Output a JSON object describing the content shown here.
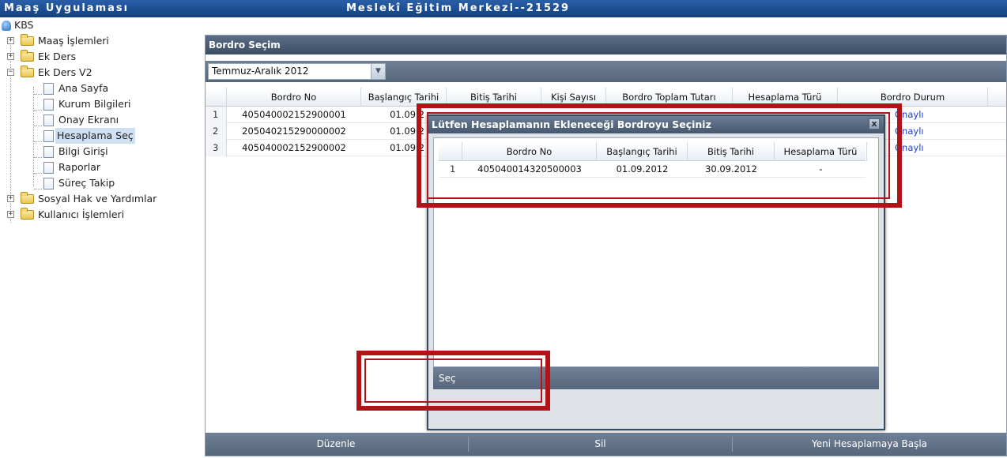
{
  "topbar": {
    "app_title": "Maaş Uygulaması",
    "center_title": "Meslekî Eğitim Merkezi--21529"
  },
  "tree": {
    "root": "KBS",
    "nodes": [
      {
        "label": "Maaş İşlemleri",
        "type": "folder",
        "expander": "+"
      },
      {
        "label": "Ek Ders",
        "type": "folder",
        "expander": "+"
      },
      {
        "label": "Ek Ders V2",
        "type": "folder",
        "expander": "−"
      },
      {
        "label": "Ana Sayfa",
        "type": "page"
      },
      {
        "label": "Kurum Bilgileri",
        "type": "page"
      },
      {
        "label": "Onay Ekranı",
        "type": "page"
      },
      {
        "label": "Hesaplama Seç",
        "type": "page",
        "selected": true
      },
      {
        "label": "Bilgi Girişi",
        "type": "page"
      },
      {
        "label": "Raporlar",
        "type": "page"
      },
      {
        "label": "Süreç Takip",
        "type": "page"
      },
      {
        "label": "Sosyal Hak ve Yardımlar",
        "type": "folder",
        "expander": "+"
      },
      {
        "label": "Kullanıcı İşlemleri",
        "type": "folder",
        "expander": "+"
      }
    ]
  },
  "panel": {
    "title": "Bordro Seçim",
    "period_select": "Temmuz-Aralık 2012",
    "columns": [
      "Bordro No",
      "Başlangıç Tarihi",
      "Bitiş Tarihi",
      "Kişi Sayısı",
      "Bordro Toplam Tutarı",
      "Hesaplama Türü",
      "Bordro Durum"
    ],
    "rows": [
      {
        "num": "1",
        "bordro_no": "405040002152900001",
        "baslangic": "01.09.2",
        "durum": "Onaylı"
      },
      {
        "num": "2",
        "bordro_no": "205040215290000002",
        "baslangic": "01.09.2",
        "durum": "Onaylı"
      },
      {
        "num": "3",
        "bordro_no": "405040002152900002",
        "baslangic": "01.09.2",
        "durum": "Onaylı"
      }
    ],
    "buttons": {
      "edit": "Düzenle",
      "delete": "Sil",
      "new_calc": "Yeni Hesaplamaya Başla"
    }
  },
  "dialog": {
    "title": "Lütfen Hesaplamanın Ekleneceği Bordroyu Seçiniz",
    "close_symbol": "x",
    "columns": [
      "Bordro No",
      "Başlangıç Tarihi",
      "Bitiş Tarihi",
      "Hesaplama Türü"
    ],
    "rows": [
      {
        "num": "1",
        "bordro_no": "405040014320500003",
        "baslangic": "01.09.2012",
        "bitis": "30.09.2012",
        "hesaplama_turu": "-"
      }
    ],
    "select_button": "Seç"
  },
  "colors": {
    "highlight": "#b31217",
    "header_bar": "#3c4d64",
    "link": "#1a3fd6"
  }
}
